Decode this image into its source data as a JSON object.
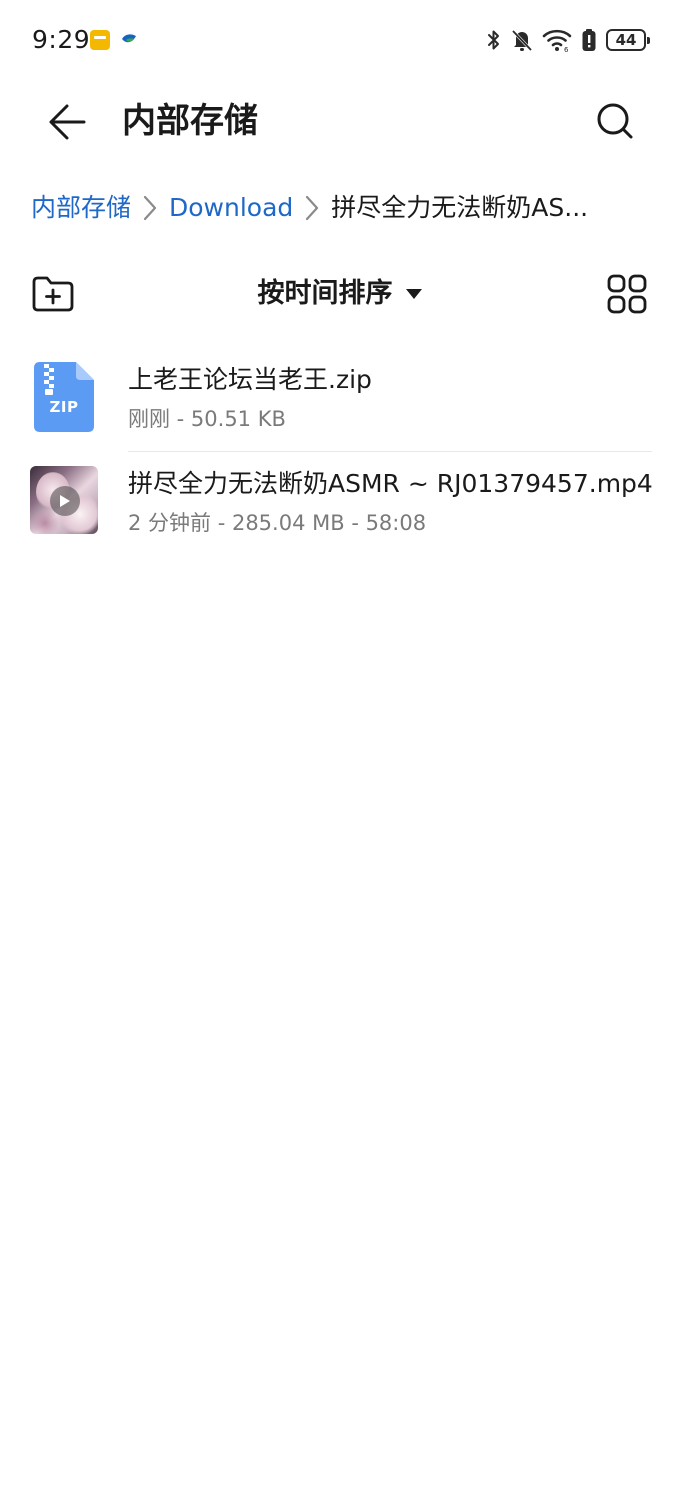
{
  "status_bar": {
    "time": "9:29",
    "battery_level": "44",
    "icons": [
      "notification-app-icon",
      "notification-app-icon-2",
      "bluetooth-icon",
      "mute-bell-icon",
      "wifi-icon",
      "battery-alert-icon",
      "battery-icon"
    ]
  },
  "title_bar": {
    "title": "内部存储",
    "back_icon": "arrow-left-icon",
    "search_icon": "search-icon"
  },
  "breadcrumb": {
    "items": [
      "内部存储",
      "Download",
      "拼尽全力无法断奶AS..."
    ]
  },
  "toolbar": {
    "sort_label": "按时间排序",
    "new_folder_icon": "new-folder-icon",
    "view_icon": "grid-view-icon",
    "dropdown_icon": "caret-down-icon"
  },
  "files": [
    {
      "name": "上老王论坛当老王.zip",
      "meta": "刚刚 - 50.51 KB",
      "type": "zip",
      "icon_label": "ZIP"
    },
    {
      "name": "拼尽全力无法断奶ASMR ~ RJ01379457.mp4",
      "meta": "2 分钟前 - 285.04 MB - 58:08",
      "type": "video"
    }
  ],
  "colors": {
    "link": "#1f68c8",
    "zip_icon": "#5b9bf4",
    "meta_text": "#7a7a7a"
  }
}
